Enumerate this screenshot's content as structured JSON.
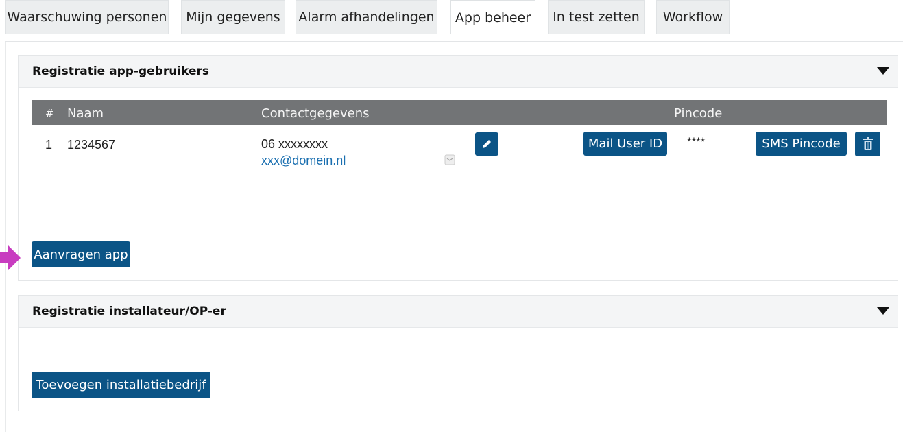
{
  "tabs": [
    {
      "label": "Waarschuwing personen",
      "active": false
    },
    {
      "label": "Mijn gegevens",
      "active": false
    },
    {
      "label": "Alarm afhandelingen",
      "active": false
    },
    {
      "label": "App beheer",
      "active": true
    },
    {
      "label": "In test zetten",
      "active": false
    },
    {
      "label": "Workflow",
      "active": false
    }
  ],
  "app_users": {
    "title": "Registratie app-gebruikers",
    "columns": {
      "index": "#",
      "name": "Naam",
      "contact": "Contactgegevens",
      "pincode": "Pincode"
    },
    "rows": [
      {
        "index": "1",
        "name": "1234567",
        "phone": "06 xxxxxxxx",
        "email": "xxx@domein.nl",
        "pincode": "****"
      }
    ],
    "mail_user_id_label": "Mail User ID",
    "sms_pincode_label": "SMS Pincode",
    "request_app_label": "Aanvragen app"
  },
  "installer": {
    "title": "Registratie installateur/OP-er",
    "add_label": "Toevoegen installatiebedrijf"
  },
  "colors": {
    "accent": "#0b5486",
    "header_bg": "#727476",
    "arrow": "#c83cc0"
  }
}
